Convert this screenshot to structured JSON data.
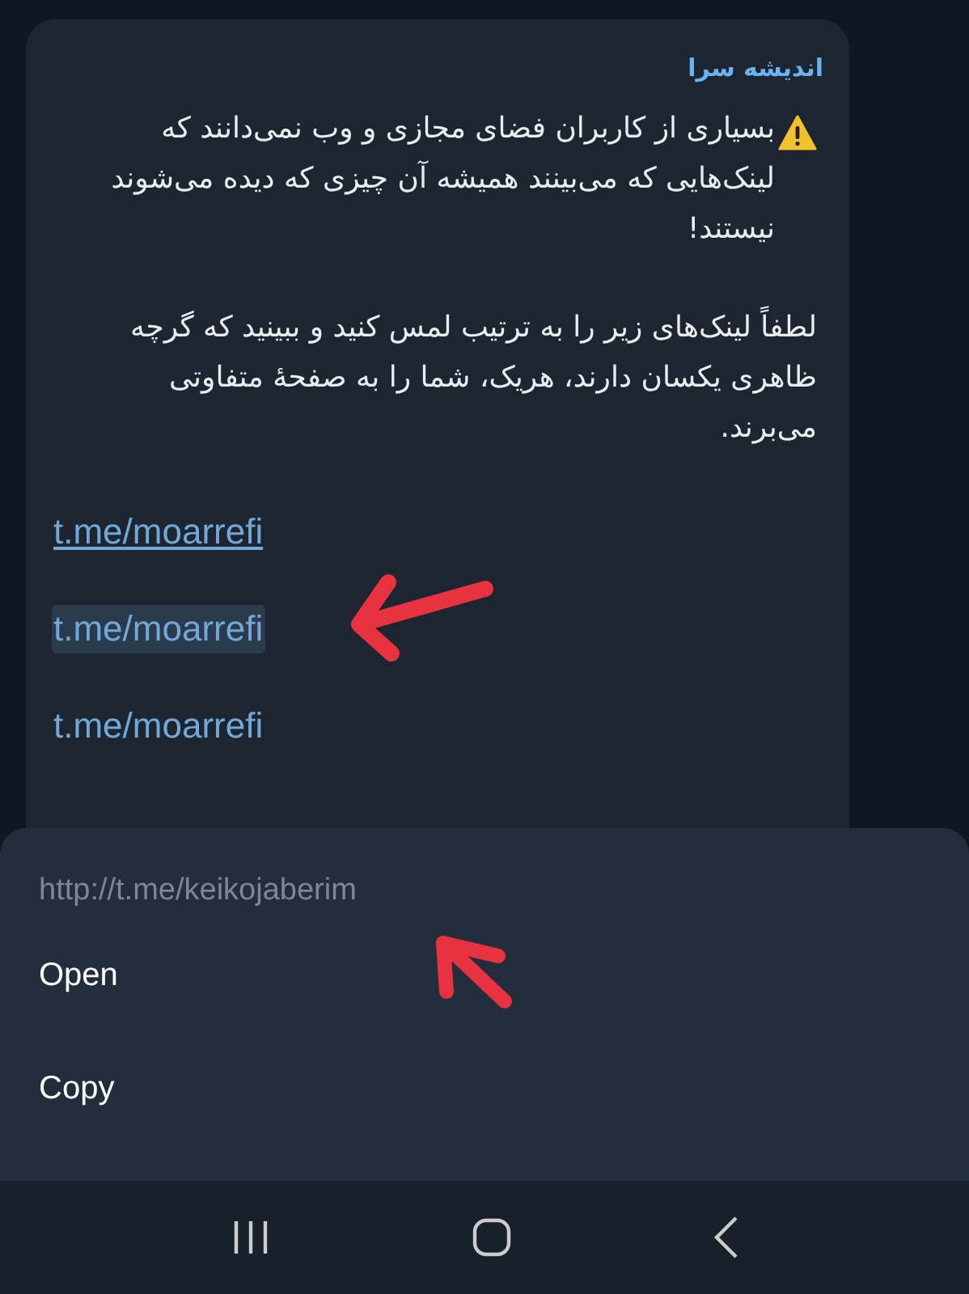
{
  "message": {
    "sender": "اندیشه سرا",
    "paragraphs": [
      "بسیاری از کاربران فضای مجازی و وب نمی‌دانند که لینک‌هایی که می‌بینند همیشه آن چیزی که دیده می‌شوند نیستند!",
      "لطفاً لینک‌های زیر را به ترتیب لمس کنید و ببینید که گرچه ظاهری یکسان دارند، هریک، شما را به صفحهٔ متفاوتی می‌برند."
    ],
    "links": [
      {
        "text": "t.me/moarrefi",
        "underlined": true,
        "selected": false
      },
      {
        "text": "t.me/moarrefi",
        "underlined": false,
        "selected": true
      },
      {
        "text": "t.me/moarrefi",
        "underlined": false,
        "selected": false
      }
    ]
  },
  "sheet": {
    "url": "http://t.me/keikojaberim",
    "actions": [
      "Open",
      "Copy"
    ]
  }
}
